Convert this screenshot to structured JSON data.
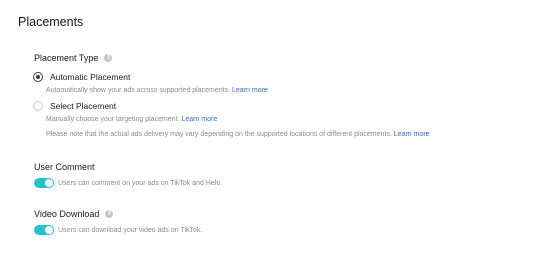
{
  "page": {
    "title": "Placements"
  },
  "placement_type": {
    "label": "Placement Type",
    "help_icon": "question-circle-icon",
    "options": [
      {
        "label": "Automatic Placement",
        "checked": true,
        "description": "Automatically show your ads across supported placements.",
        "link": "Learn more"
      },
      {
        "label": "Select Placement",
        "checked": false,
        "description": "Manually choose your targeting placement.",
        "link": "Learn more"
      }
    ],
    "note": "Please note that the actual ads delivery may vary depending on the supported locations of different placements.",
    "note_link": "Learn more"
  },
  "user_comment": {
    "label": "User Comment",
    "enabled": true,
    "description": "Users can comment on your ads on TikTok and Helo."
  },
  "video_download": {
    "label": "Video Download",
    "help_icon": "question-circle-icon",
    "enabled": true,
    "description": "Users can download your video ads on TikTok."
  },
  "colors": {
    "accent": "#25c3c9",
    "link": "#2e6cd8",
    "muted": "#8a8b91"
  }
}
